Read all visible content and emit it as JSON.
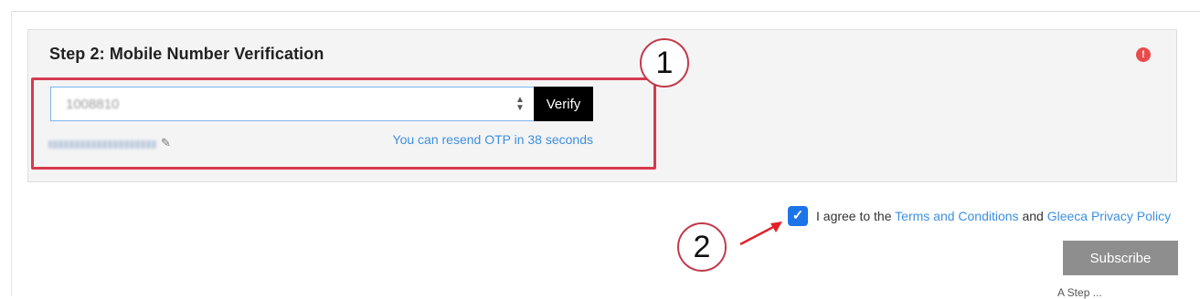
{
  "panel": {
    "title": "Step 2: Mobile Number Verification",
    "alert_icon": "exclamation-circle-icon",
    "alert_glyph": "!",
    "alert_color": "#e94b4b"
  },
  "phone": {
    "value": "1008810",
    "verify_label": "Verify"
  },
  "otp": {
    "resend_text": "You can resend OTP in 38 seconds"
  },
  "annotations": {
    "callout_1": "1",
    "callout_2": "2",
    "highlight_color": "#d63a4e"
  },
  "agreement": {
    "checked": true,
    "prefix": "I agree to the",
    "terms_link": "Terms and Conditions",
    "conjunction": "and",
    "privacy_link": "Gleeca Privacy Policy",
    "checkbox_color": "#1c74e9"
  },
  "subscribe": {
    "label": "Subscribe"
  },
  "footer": {
    "cutoff_text": "A Step ..."
  }
}
